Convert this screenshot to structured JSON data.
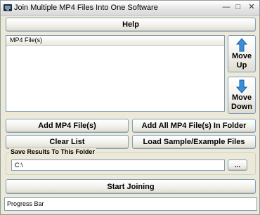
{
  "window": {
    "title": "Join Multiple MP4 Files Into One Software",
    "icon": "app-icon",
    "controls": [
      "minimize",
      "maximize",
      "close"
    ]
  },
  "help_button": "Help",
  "file_list": {
    "column_header": "MP4 File(s)",
    "items": []
  },
  "move_up": {
    "line1": "Move",
    "line2": "Up",
    "icon": "arrow-up-icon"
  },
  "move_down": {
    "line1": "Move",
    "line2": "Down",
    "icon": "arrow-down-icon"
  },
  "buttons": {
    "add_files": "Add MP4 File(s)",
    "add_folder": "Add All MP4 File(s) In Folder",
    "clear_list": "Clear List",
    "load_sample": "Load Sample/Example Files",
    "browse": "...",
    "start": "Start Joining"
  },
  "save_group": {
    "label": "Save Results To This Folder",
    "path": "C:\\"
  },
  "progress_bar": {
    "text": "Progress Bar"
  },
  "colors": {
    "arrow": "#3a8fd8",
    "background": "#ece9d8",
    "border": "#7f9db9"
  }
}
